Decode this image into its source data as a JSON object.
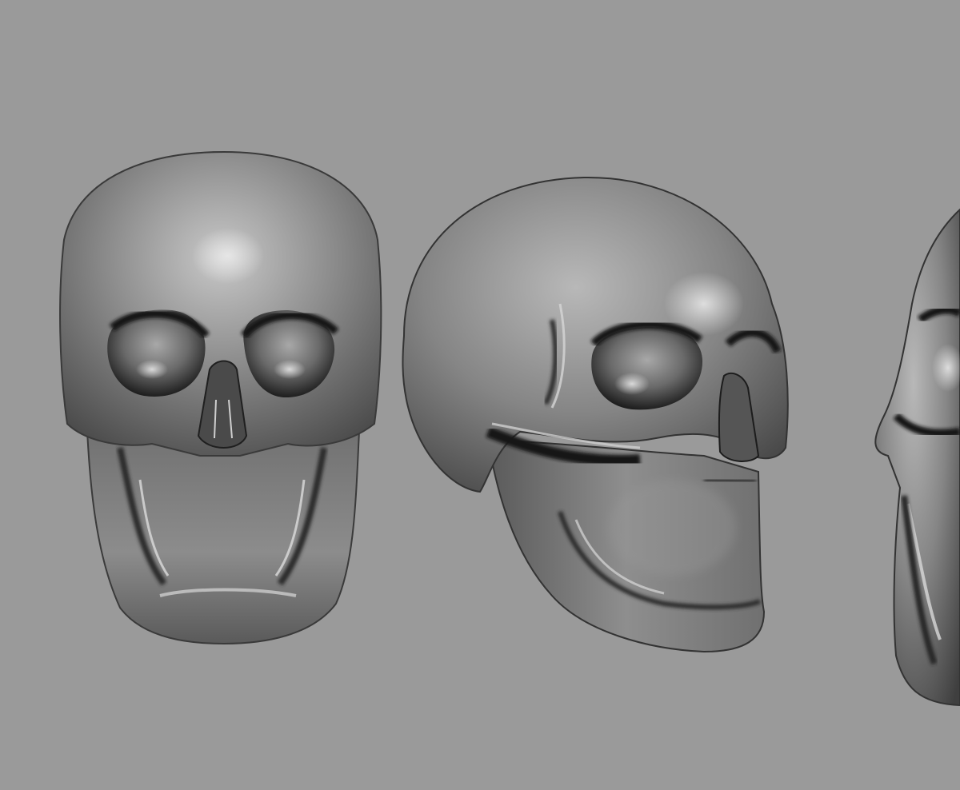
{
  "viewport": {
    "background_color": "#9a9a9a"
  },
  "render": {
    "material_base_color": "#8a8a8a",
    "material_highlight_color": "#e8e8e8",
    "material_shadow_color": "#1e1e1e"
  },
  "models": [
    {
      "label": "",
      "view": "front",
      "icon": "skull-front-view"
    },
    {
      "label": "",
      "view": "three-quarter-right",
      "icon": "skull-three-quarter-view"
    },
    {
      "label": "",
      "view": "side-cropped",
      "icon": "skull-side-view"
    }
  ]
}
